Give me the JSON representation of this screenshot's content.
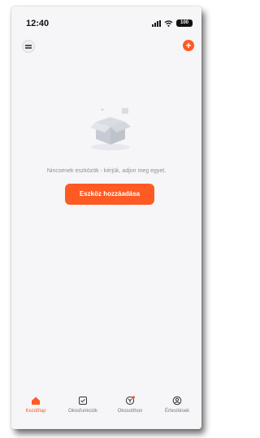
{
  "status_bar": {
    "time": "12:40",
    "battery": "100"
  },
  "main": {
    "empty_message": "Nincsenek eszközök - kérjük, adjon meg egyet.",
    "add_device_button": "Eszköz hozzáadása"
  },
  "tabs": [
    {
      "label": "Kezdőlap",
      "icon": "home-icon",
      "active": true
    },
    {
      "label": "Okosfunkciók",
      "icon": "checklist-icon",
      "active": false
    },
    {
      "label": "Okosotthon",
      "icon": "smart-home-icon",
      "active": false
    },
    {
      "label": "Értesítések",
      "icon": "profile-icon",
      "active": false
    }
  ],
  "colors": {
    "accent": "#ff5a23",
    "background": "#f6f6f8",
    "muted_text": "#8a8f98"
  }
}
